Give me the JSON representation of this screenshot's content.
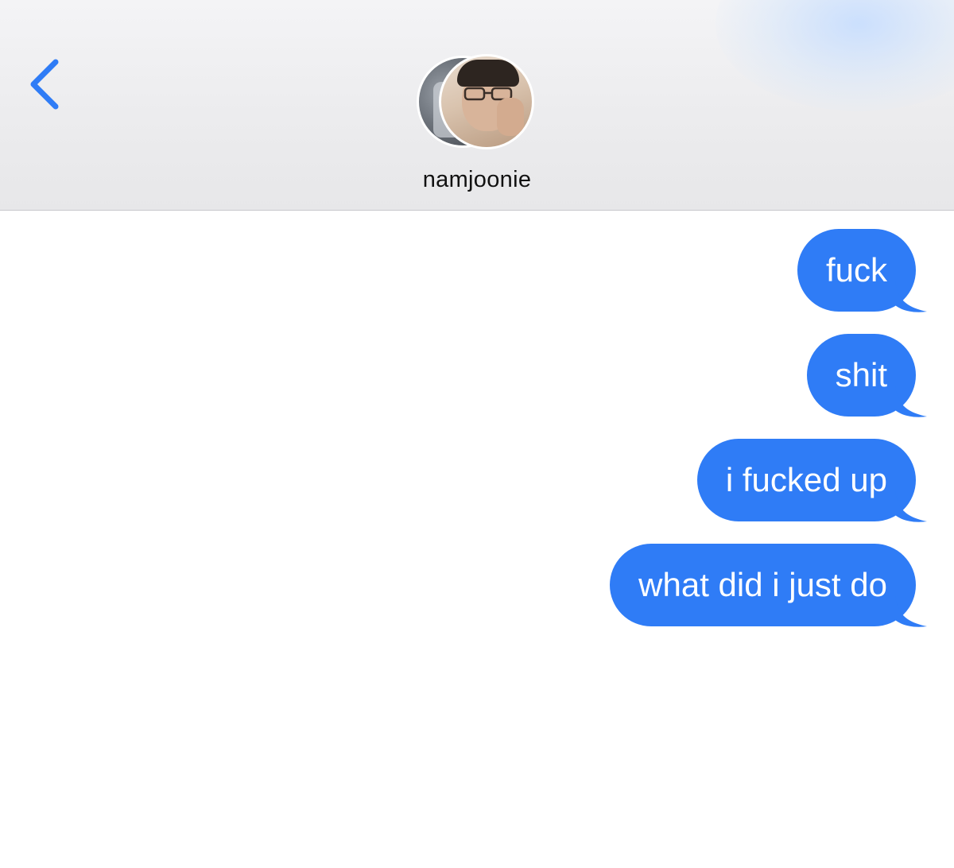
{
  "header": {
    "contact_name": "namjoonie",
    "icons": {
      "back": "chevron-left-icon"
    }
  },
  "thread": {
    "messages": [
      {
        "text": "fuck",
        "sender": "me"
      },
      {
        "text": "shit",
        "sender": "me"
      },
      {
        "text": "i fucked up",
        "sender": "me"
      },
      {
        "text": "what did i just do",
        "sender": "me"
      }
    ]
  },
  "colors": {
    "accent": "#2f7cf6",
    "back_chevron": "#2f7cf6",
    "header_bg": "#ececee",
    "bubble_text": "#ffffff"
  }
}
